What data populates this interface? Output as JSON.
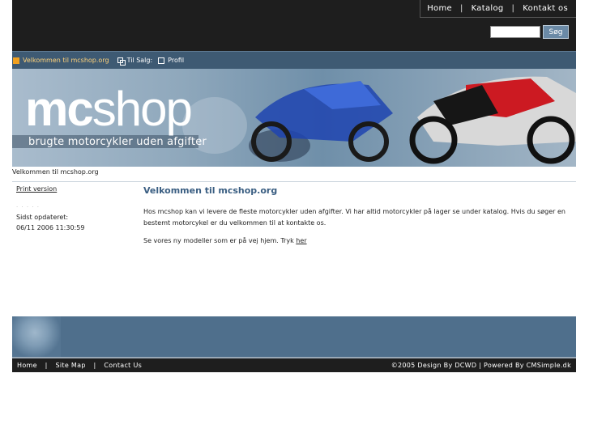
{
  "topnav": {
    "home": "Home",
    "katalog": "Katalog",
    "kontakt": "Kontakt os",
    "sep": "|"
  },
  "search": {
    "value": "",
    "button": "Søg"
  },
  "menu": {
    "item1": "Velkommen til mcshop.org",
    "item2": "Til Salg:",
    "item3": "Profil"
  },
  "banner": {
    "logo_bold": "mc",
    "logo_light": "shop",
    "tagline": "brugte motorcykler uden afgifter"
  },
  "breadcrumb": "Velkommen til mcshop.org",
  "sidebar": {
    "print": "Print version",
    "dots": "· · · · ·",
    "updated_label": "Sidst opdateret:",
    "updated_value": "06/11 2006 11:30:59"
  },
  "main": {
    "title": "Velkommen til mcshop.org",
    "para1": "Hos mcshop kan vi levere de fleste motorcykler uden afgifter. Vi har altid motorcykler på lager se under katalog. Hvis du søger en bestemt motorcykel er du velkommen til at kontakte os.",
    "para2": "Se vores ny modeller som er på vej hjem. Tryk",
    "link": "her"
  },
  "footer": {
    "home": "Home",
    "sitemap": "Site Map",
    "contact": "Contact Us",
    "sep": "|",
    "credit": "©2005 Design By DCWD | Powered By CMSimple.dk"
  },
  "colors": {
    "topbar": "#1e1e1e",
    "menu": "#3e5a73",
    "title": "#3a5e82",
    "footer": "#4f6f8c"
  }
}
